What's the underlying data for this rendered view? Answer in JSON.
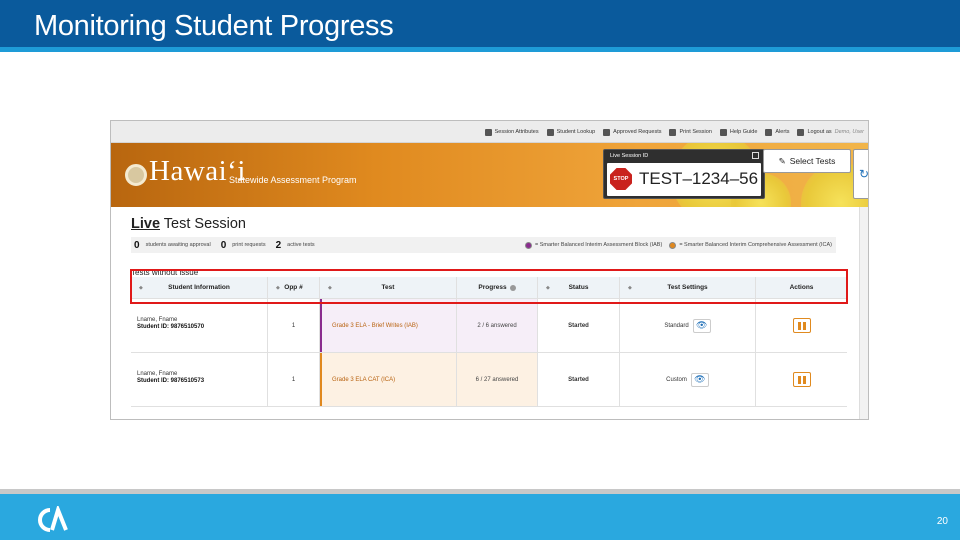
{
  "slide": {
    "title": "Monitoring Student Progress",
    "page_number": "20",
    "logo_text": "CA"
  },
  "topnav": {
    "items": [
      {
        "label": "Session Attributes",
        "icon": "gear-icon"
      },
      {
        "label": "Student Lookup",
        "icon": "search-icon"
      },
      {
        "label": "Approved Requests",
        "icon": "document-icon"
      },
      {
        "label": "Print Session",
        "icon": "printer-icon"
      },
      {
        "label": "Help Guide",
        "icon": "help-icon"
      },
      {
        "label": "Alerts",
        "icon": "alert-icon"
      }
    ],
    "logout_label": "Logout as",
    "user_name": "Demo, User"
  },
  "banner": {
    "brand": "Hawai‘i",
    "program": "Statewide Assessment Program",
    "session_box_label": "Live  Session ID",
    "stop_text": "STOP",
    "session_id": "TEST–1234–56",
    "select_tests_label": "Select Tests",
    "refresh_glyph": "↻"
  },
  "main": {
    "heading_live": "Live",
    "heading_rest": " Test Session",
    "summary": [
      {
        "count": "0",
        "label": "students awaiting approval"
      },
      {
        "count": "0",
        "label": "print requests"
      },
      {
        "count": "2",
        "label": "active tests"
      }
    ],
    "legend": [
      {
        "label": "= Smarter Balanced Interim Assessment Block (IAB)",
        "color": "#8a2c8e"
      },
      {
        "label": "= Smarter Balanced Interim Comprehensive Assessment (ICA)",
        "color": "#e0881e"
      }
    ],
    "tests_label": "Tests without issue",
    "columns": [
      "Student Information",
      "Opp #",
      "Test",
      "Progress",
      "Status",
      "Test Settings",
      "Actions"
    ],
    "rows": [
      {
        "name": "Lname, Fname",
        "student_id": "Student ID: 9876510570",
        "opp": "1",
        "test": "Grade 3 ELA - Brief Writes (IAB)",
        "progress": "2 / 6 answered",
        "status": "Started",
        "settings": "Standard",
        "kind": "iab"
      },
      {
        "name": "Lname, Fname",
        "student_id": "Student ID: 9876510573",
        "opp": "1",
        "test": "Grade 3 ELA CAT (ICA)",
        "progress": "6 / 27 answered",
        "status": "Started",
        "settings": "Custom",
        "kind": "ica"
      }
    ]
  },
  "colors": {
    "title_bar": "#0a5a9c",
    "footer": "#2aa8df",
    "highlight": "#e01919",
    "iab_accent": "#8a2c8e",
    "ica_accent": "#e0881e"
  }
}
